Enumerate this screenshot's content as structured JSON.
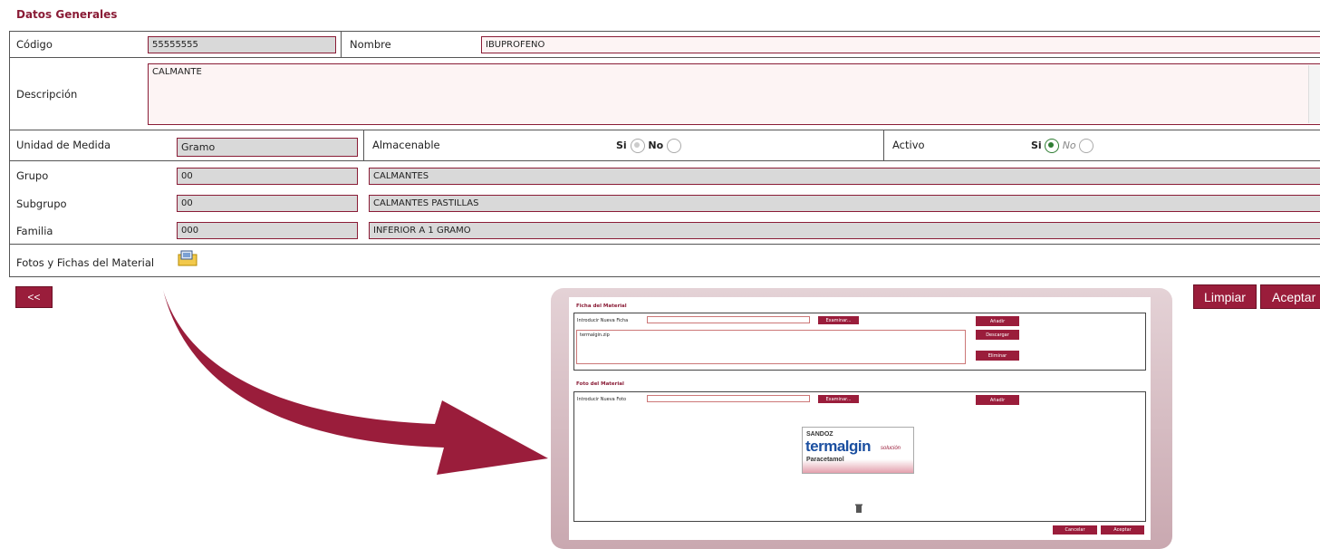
{
  "section_title": "Datos Generales",
  "fields": {
    "codigo": {
      "label": "Código",
      "value": "55555555"
    },
    "nombre": {
      "label": "Nombre",
      "value": "IBUPROFENO"
    },
    "descripcion": {
      "label": "Descripción",
      "value": "CALMANTE"
    },
    "unidad": {
      "label": "Unidad de Medida",
      "value": "Gramo"
    },
    "almacenable": {
      "label": "Almacenable",
      "si": "Si",
      "no": "No"
    },
    "activo": {
      "label": "Activo",
      "si": "Si",
      "no": "No"
    },
    "grupo": {
      "label": "Grupo",
      "code": "00",
      "name": "CALMANTES"
    },
    "subgrupo": {
      "label": "Subgrupo",
      "code": "00",
      "name": "CALMANTES PASTILLAS"
    },
    "familia": {
      "label": "Familia",
      "code": "000",
      "name": "INFERIOR A 1 GRAMO"
    },
    "fotos": {
      "label": "Fotos y Fichas del Material"
    }
  },
  "buttons": {
    "back": "<<",
    "limpiar": "Limpiar",
    "aceptar": "Aceptar"
  },
  "popup": {
    "ficha_title": "Ficha del Material",
    "nueva_ficha_label": "Introducir Nueva Ficha",
    "examinar": "Examinar...",
    "anadir": "Añadir",
    "descargar": "Descargar",
    "eliminar": "Eliminar",
    "file": "termalgin.zip",
    "foto_title": "Foto del Material",
    "nueva_foto_label": "Introducir Nueva Foto",
    "cancelar": "Cancelar",
    "aceptar": "Aceptar",
    "product": {
      "brand": "SANDOZ",
      "name": "termalgin",
      "variant": "solución",
      "sub": "Paracetamol"
    }
  },
  "colors": {
    "accent": "#9a1d3b",
    "title": "#8a1c36"
  }
}
